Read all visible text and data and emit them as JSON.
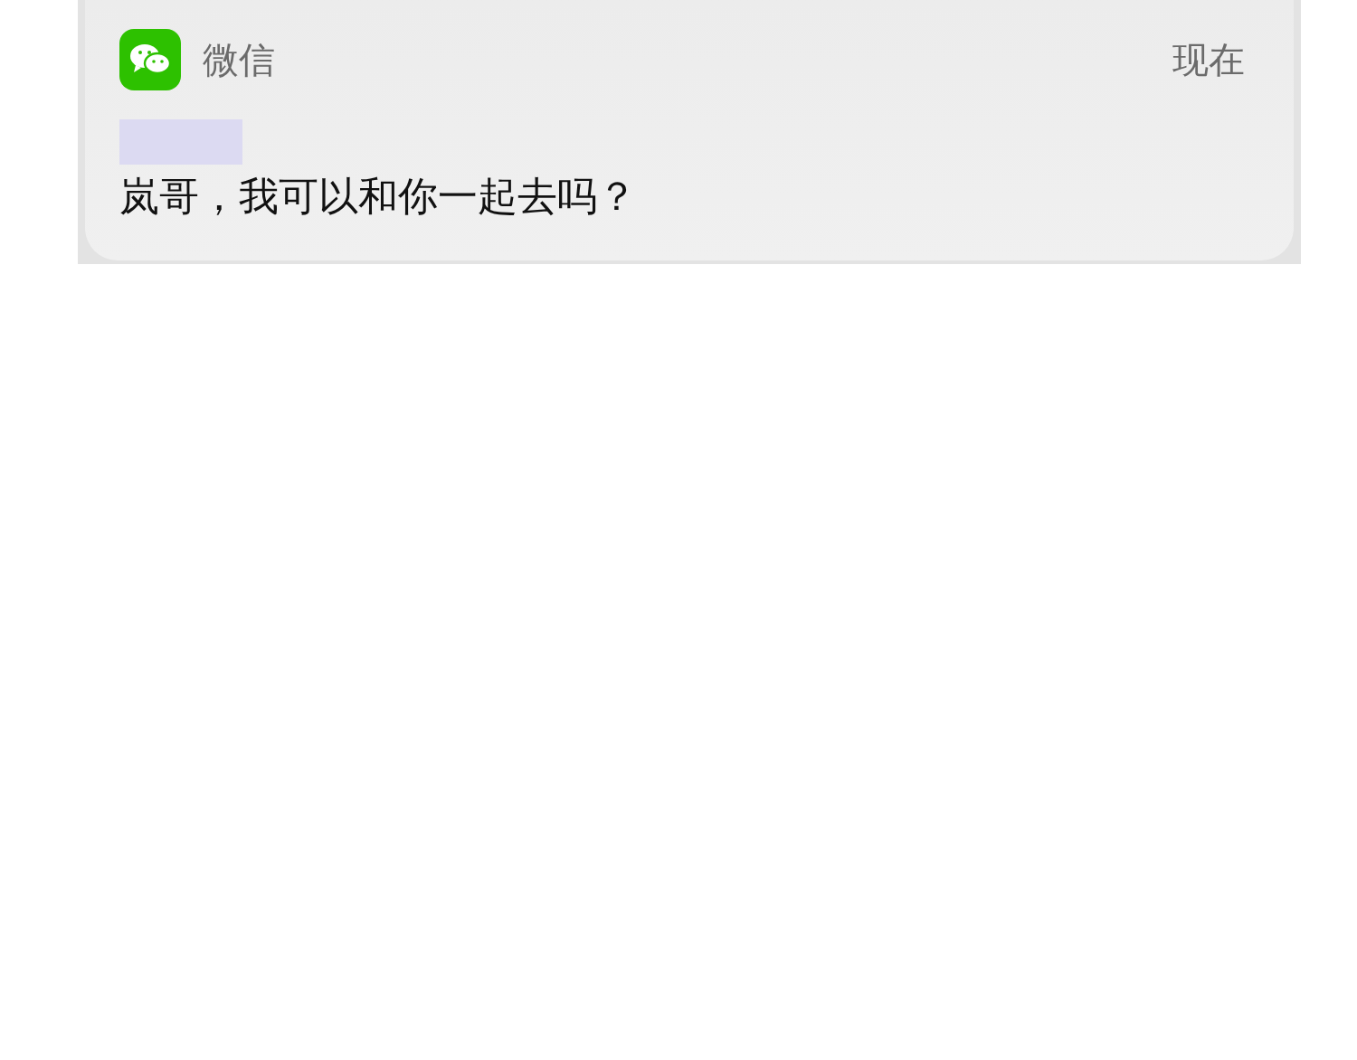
{
  "notification": {
    "app_name": "微信",
    "time": "现在",
    "message": "岚哥，我可以和你一起去吗？"
  }
}
